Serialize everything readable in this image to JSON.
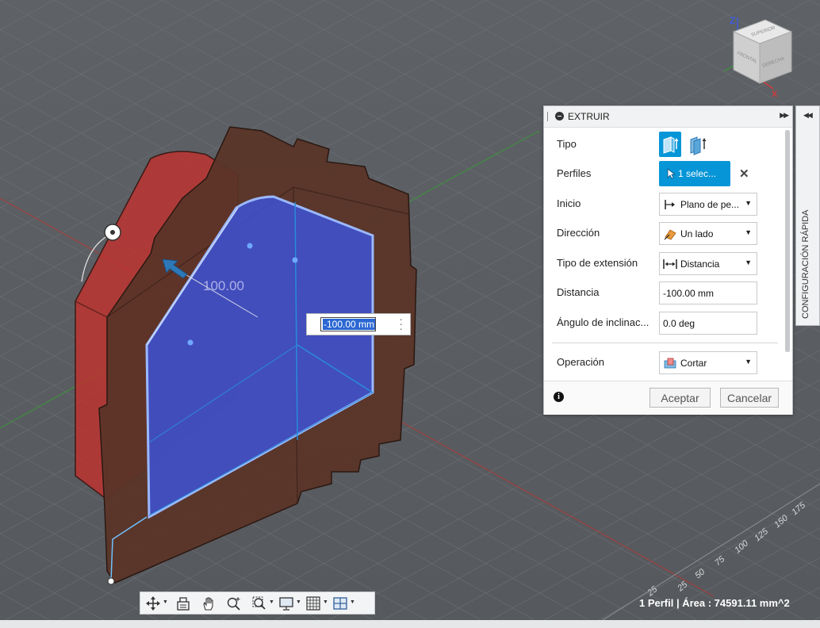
{
  "extrude_panel": {
    "title": "EXTRUIR",
    "rows": {
      "tipo": {
        "label": "Tipo"
      },
      "perfiles": {
        "label": "Perfiles",
        "value": "1 selec..."
      },
      "inicio": {
        "label": "Inicio",
        "value": "Plano de pe..."
      },
      "direccion": {
        "label": "Dirección",
        "value": "Un lado"
      },
      "tipo_extension": {
        "label": "Tipo de extensión",
        "value": "Distancia"
      },
      "distancia": {
        "label": "Distancia",
        "value": "-100.00 mm"
      },
      "angulo": {
        "label": "Ángulo de inclinac...",
        "value": "0.0 deg"
      },
      "operacion": {
        "label": "Operación",
        "value": "Cortar"
      }
    },
    "ok_label": "Aceptar",
    "cancel_label": "Cancelar"
  },
  "quick_settings": {
    "label": "CONFIGURACIÓN RÁPIDA"
  },
  "viewport": {
    "distance_input": "-100.00 mm",
    "dimension_label": "100.00",
    "grid_labels": [
      "175",
      "150",
      "125",
      "100",
      "75",
      "50",
      "25",
      "25"
    ],
    "viewcube": {
      "axis_z": "Z",
      "axis_x": "X",
      "faces": [
        "SUPERIOR",
        "DERECHA",
        "FRONTAL"
      ]
    },
    "nav_tools": [
      "orbit-icon",
      "look-at-icon",
      "pan-icon",
      "zoom-icon",
      "fit-icon",
      "display-settings-icon",
      "grid-settings-icon",
      "viewports-icon"
    ]
  },
  "status": {
    "text": "1 Perfil | Área : 74591.11 mm^2"
  },
  "colors": {
    "accent": "#0696d7",
    "sketch_profile": "#3d52d6",
    "cut_body": "#c0322e",
    "wood_body": "#5a3427",
    "background": "#5b5f63"
  }
}
